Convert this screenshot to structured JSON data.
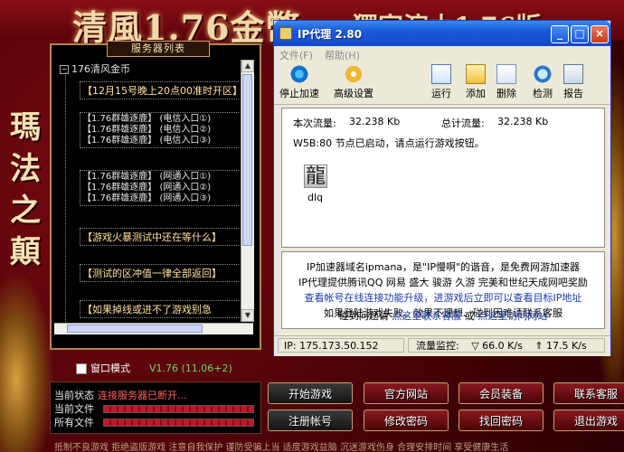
{
  "launcher": {
    "banner_title": "清風1.76金幣",
    "banner_title2": "獨家演木1.76版",
    "side_text": [
      "瑪",
      "法",
      "之",
      "顛"
    ],
    "server_list_caption": "服务器列表",
    "tree_root": "176清风金币",
    "tree_items": [
      {
        "type": "item",
        "text": "【12月15号晚上20点00准时开区】"
      },
      {
        "type": "group",
        "lines": [
          "【1.76群雄逐鹿】 (电信入口①)",
          "【1.76群雄逐鹿】 (电信入口②)",
          "【1.76群雄逐鹿】 (电信入口③)"
        ]
      },
      {
        "type": "group",
        "lines": [
          "【1.76群雄逐鹿】 (网通入口①)",
          "【1.76群雄逐鹿】 (网通入口②)",
          "【1.76群雄逐鹿】 (网通入口③)"
        ]
      },
      {
        "type": "item",
        "text": "【游戏火暴测试中还在等什么】"
      },
      {
        "type": "item",
        "text": "【测试的区冲值一律全部返回】"
      },
      {
        "type": "item",
        "text": "【如果掉线或进不了游戏别急"
      }
    ],
    "window_mode_label": "窗口模式",
    "version": "V1.76 (11.06+2)",
    "status": {
      "current_status_label": "当前状态",
      "current_status_value": "连接服务器已断开...",
      "current_file_label": "当前文件",
      "all_files_label": "所有文件"
    },
    "buttons": [
      "开始游戏",
      "官方网站",
      "会员装备",
      "联系客服",
      "注册帐号",
      "修改密码",
      "找回密码",
      "退出游戏"
    ],
    "footer": "抵制不良游戏 拒绝盗版游戏 注意自我保护 谨防受骗上当 适度游戏益脑 沉迷游戏伤身 合理安排时间 享受健康生活"
  },
  "ipproxy": {
    "title": "IP代理 2.80",
    "menu": [
      "文件(F)",
      "帮助(H)"
    ],
    "toolbar": [
      "停止加速",
      "高级设置",
      "运行",
      "添加",
      "删除",
      "检测",
      "报告"
    ],
    "this_traffic_label": "本次流量:",
    "this_traffic_value": "32.238 Kb",
    "total_traffic_label": "总计流量:",
    "total_traffic_value": "32.238 Kb",
    "node_status": "W5B:80 节点已启动，请点运行游戏按钮。",
    "icon_glyph": "龍",
    "icon_label": "dlq",
    "info_lines": [
      "IP加速器域名ipmana，是\"IP慢啊\"的谐音，是免费网游加速器",
      "IP代理提供腾讯QQ 网易 盛大 骏游 久游 完美和世纪天成网吧奖励",
      "查看帐号在线连接功能升级，进游戏后立即可以查看目标IP地址",
      "如果登陆游戏失败、效果不理想、碰到困难请联系客服"
    ],
    "help_prefix": "碰到问题请",
    "help_link1": "点这里联系客服",
    "help_or": "或",
    "help_link2": "点这里访问网站",
    "status_ip": "IP: 175.173.50.152",
    "status_traffic_label": "流量监控:",
    "status_down": "▽ 66.0 K/s",
    "status_up": "⇑ 17.5 K/s",
    "colors": {
      "titlebar": "#1a5ad8",
      "link": "#1a3aa8",
      "status_error": "#ff6060"
    }
  }
}
